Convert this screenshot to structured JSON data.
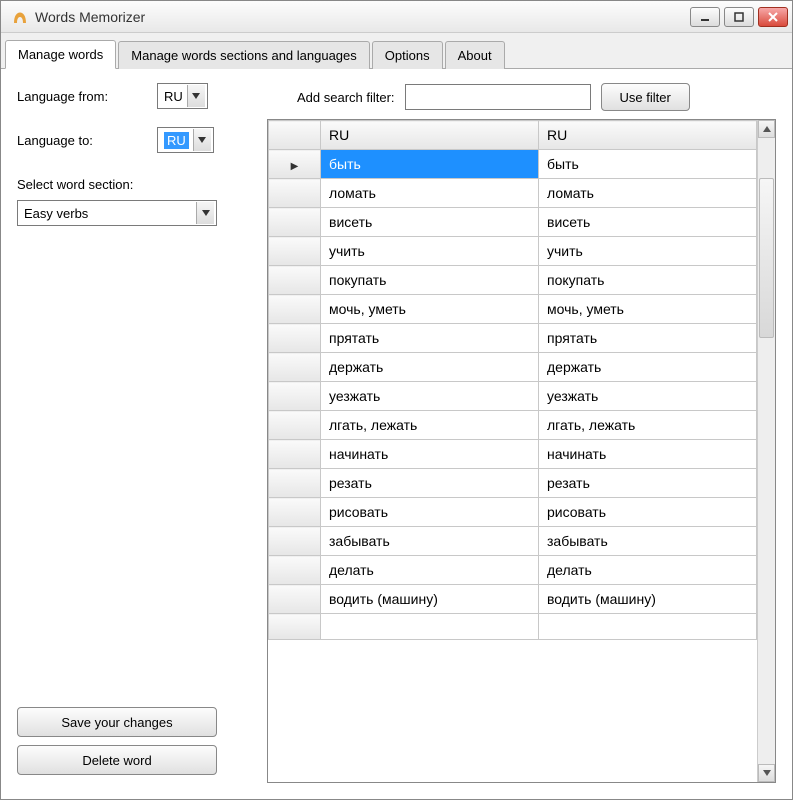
{
  "window": {
    "title": "Words Memorizer"
  },
  "tabs": [
    {
      "label": "Manage words",
      "active": true
    },
    {
      "label": "Manage words sections and languages",
      "active": false
    },
    {
      "label": "Options",
      "active": false
    },
    {
      "label": "About",
      "active": false
    }
  ],
  "left": {
    "lang_from_label": "Language from:",
    "lang_from_value": "RU",
    "lang_to_label": "Language to:",
    "lang_to_value": "RU",
    "section_label": "Select word section:",
    "section_value": "Easy verbs",
    "save_label": "Save your changes",
    "delete_label": "Delete word"
  },
  "filter": {
    "label": "Add search filter:",
    "value": "",
    "button": "Use filter"
  },
  "grid": {
    "col1": "RU",
    "col2": "RU",
    "rows": [
      {
        "a": "быть",
        "b": "быть",
        "selected": true
      },
      {
        "a": "ломать",
        "b": "ломать"
      },
      {
        "a": "висеть",
        "b": "висеть"
      },
      {
        "a": "учить",
        "b": "учить"
      },
      {
        "a": "покупать",
        "b": "покупать"
      },
      {
        "a": "мочь, уметь",
        "b": "мочь, уметь"
      },
      {
        "a": "прятать",
        "b": "прятать"
      },
      {
        "a": "держать",
        "b": "держать"
      },
      {
        "a": "уезжать",
        "b": "уезжать"
      },
      {
        "a": "лгать, лежать",
        "b": "лгать, лежать"
      },
      {
        "a": "начинать",
        "b": "начинать"
      },
      {
        "a": "резать",
        "b": "резать"
      },
      {
        "a": "рисовать",
        "b": "рисовать"
      },
      {
        "a": "забывать",
        "b": "забывать"
      },
      {
        "a": "делать",
        "b": "делать"
      },
      {
        "a": "водить (машину)",
        "b": "водить (машину)"
      }
    ]
  }
}
